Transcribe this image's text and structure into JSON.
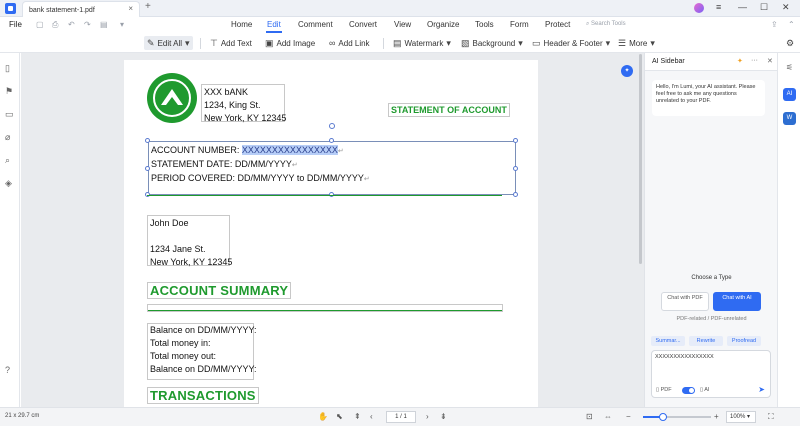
{
  "titlebar": {
    "tab_label": "bank statement-1.pdf",
    "tab_close": "×",
    "new_tab": "+"
  },
  "menubar": {
    "file": "File",
    "items": [
      "Home",
      "Edit",
      "Comment",
      "Convert",
      "View",
      "Organize",
      "Tools",
      "Form",
      "Protect"
    ],
    "active": "Edit",
    "search_placeholder": "Search Tools"
  },
  "toolbar": {
    "edit_all": "Edit All",
    "add_text": "Add Text",
    "add_image": "Add Image",
    "add_link": "Add Link",
    "watermark": "Watermark",
    "background": "Background",
    "header_footer": "Header & Footer",
    "more": "More"
  },
  "document": {
    "bank": {
      "name": "XXX bANK",
      "street": "1234, King St.",
      "city": "New York, KY 12345"
    },
    "statement_title": "STATEMENT OF ACCOUNT",
    "account_number_label": "ACCOUNT NUMBER: ",
    "account_number_value": "XXXXXXXXXXXXXXXX",
    "statement_date": "STATEMENT DATE: DD/MM/YYYY",
    "period_covered": "PERIOD COVERED: DD/MM/YYYY to DD/MM/YYYY",
    "customer": {
      "name": "John Doe",
      "street": "1234 Jane St.",
      "city": "New York, KY 12345"
    },
    "account_summary_heading": "ACCOUNT SUMMARY",
    "balance_lines": [
      "Balance on DD/MM/YYYY:",
      "Total money in:",
      "Total money out:",
      "Balance on DD/MM/YYYY:"
    ],
    "transactions_heading": "TRANSACTIONS"
  },
  "statusbar": {
    "page_size": "21 x 29.7 cm",
    "page_indicator": "1 / 1",
    "zoom": "100%",
    "zoom_fraction": 0.3
  },
  "ai_sidebar": {
    "title": "AI Sidebar",
    "greeting": "Hello, I'm Lumi, your AI assistant. Please feel free to ask me any questions unrelated to your PDF.",
    "choose_type": "Choose a Type",
    "chat_pdf": "Chat with PDF",
    "chat_ai": "Chat with AI",
    "type_sub": "PDF-related / PDF-unrelated",
    "tabs": [
      "Summar...",
      "Rewrite",
      "Proofread"
    ],
    "input_value": "XXXXXXXXXXXXXXXX",
    "pdf_label": "PDF",
    "ai_label": "AI"
  },
  "right_rail": {
    "ai_badge": "AI",
    "word_badge": "W"
  },
  "colors": {
    "accent": "#2f6bf2",
    "bank_green": "#1f9a2e"
  }
}
